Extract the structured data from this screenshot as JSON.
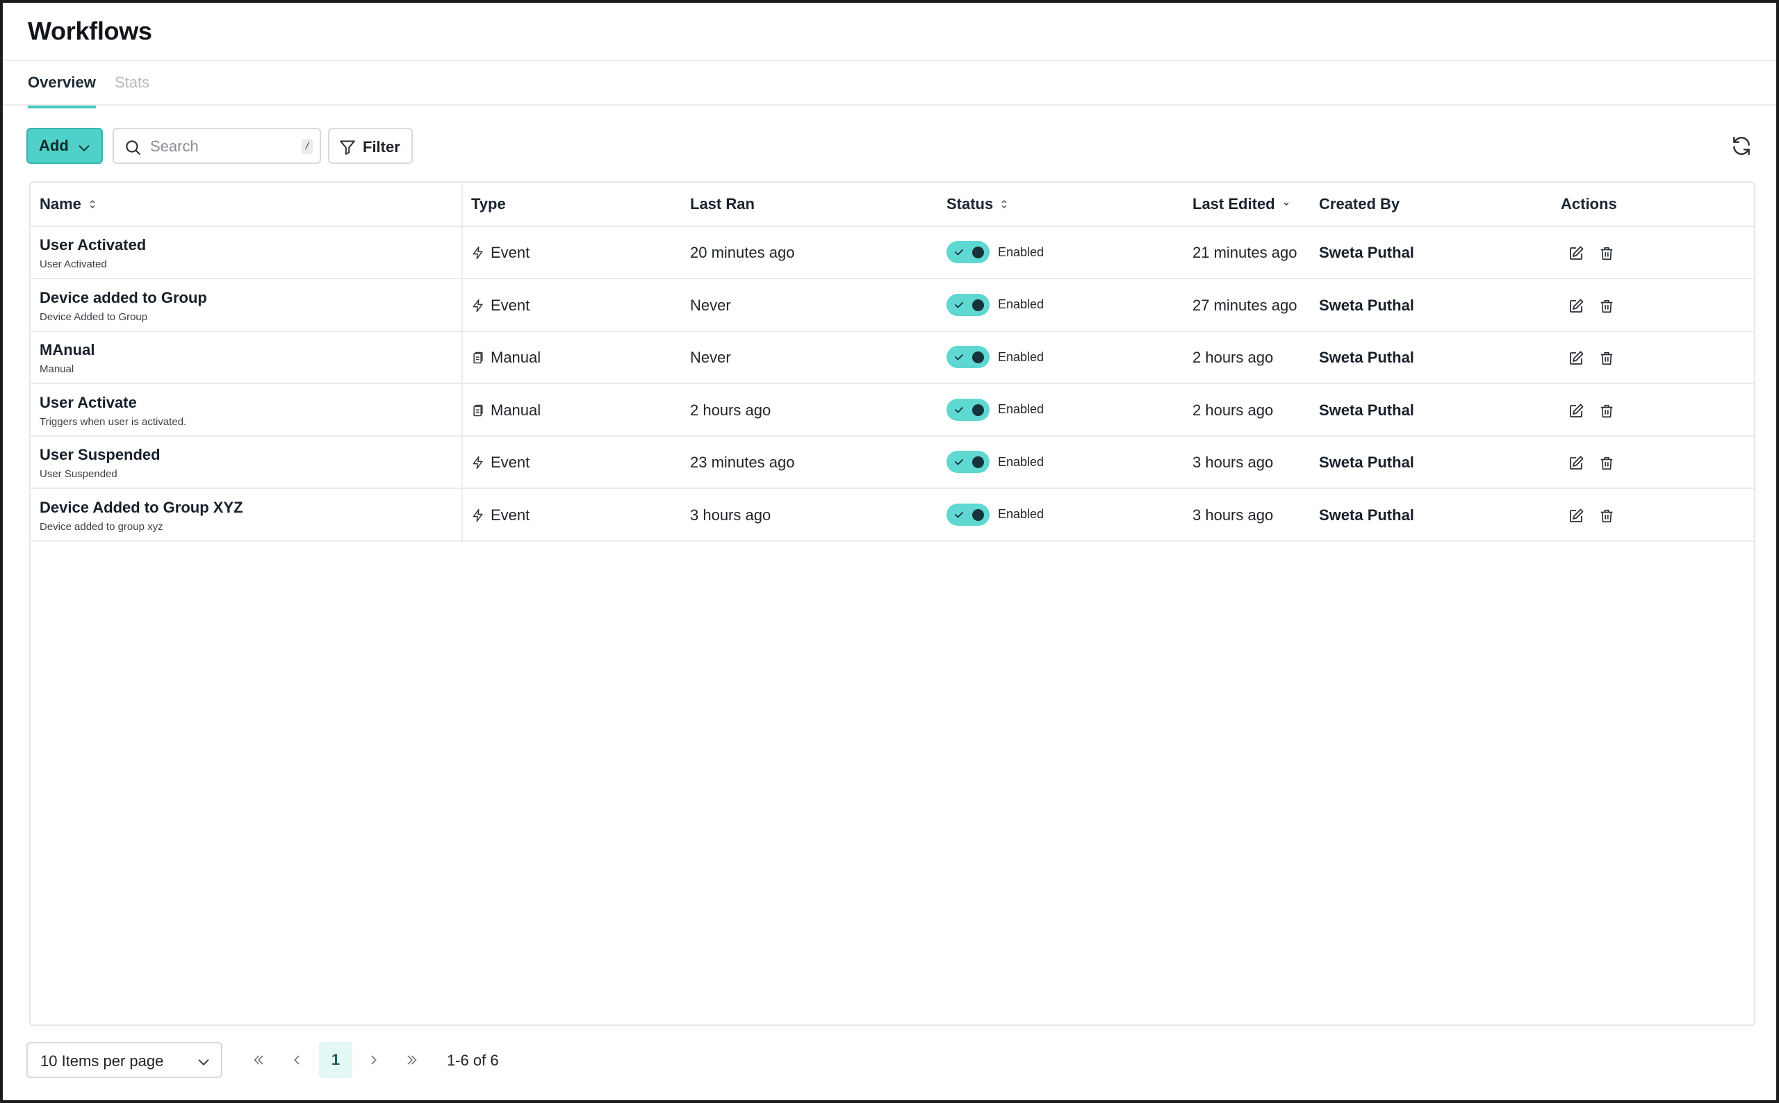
{
  "page": {
    "title": "Workflows"
  },
  "tabs": [
    {
      "label": "Overview",
      "active": true
    },
    {
      "label": "Stats",
      "active": false
    }
  ],
  "toolbar": {
    "add_label": "Add",
    "search_placeholder": "Search",
    "search_shortcut": "/",
    "filter_label": "Filter"
  },
  "table": {
    "columns": [
      "Name",
      "Type",
      "Last Ran",
      "Status",
      "Last Edited",
      "Created By",
      "Actions"
    ],
    "rows": [
      {
        "name": "User Activated",
        "description": "User Activated",
        "type": "Event",
        "last_ran": "20 minutes ago",
        "status": "Enabled",
        "last_edited": "21 minutes ago",
        "created_by": "Sweta Puthal"
      },
      {
        "name": "Device added to Group",
        "description": "Device Added to Group",
        "type": "Event",
        "last_ran": "Never",
        "status": "Enabled",
        "last_edited": "27 minutes ago",
        "created_by": "Sweta Puthal"
      },
      {
        "name": "MAnual",
        "description": "Manual",
        "type": "Manual",
        "last_ran": "Never",
        "status": "Enabled",
        "last_edited": "2 hours ago",
        "created_by": "Sweta Puthal"
      },
      {
        "name": "User Activate",
        "description": "Triggers when user is activated.",
        "type": "Manual",
        "last_ran": "2 hours ago",
        "status": "Enabled",
        "last_edited": "2 hours ago",
        "created_by": "Sweta Puthal"
      },
      {
        "name": "User Suspended",
        "description": "User Suspended",
        "type": "Event",
        "last_ran": "23 minutes ago",
        "status": "Enabled",
        "last_edited": "3 hours ago",
        "created_by": "Sweta Puthal"
      },
      {
        "name": "Device Added to Group XYZ",
        "description": "Device added to group xyz",
        "type": "Event",
        "last_ran": "3 hours ago",
        "status": "Enabled",
        "last_edited": "3 hours ago",
        "created_by": "Sweta Puthal"
      }
    ]
  },
  "pagination": {
    "per_page_label": "10 Items per page",
    "current_page": "1",
    "range": "1-6 of 6"
  },
  "colors": {
    "accent": "#4fd1c9",
    "toggle_on": "#5ed8d0",
    "tab_underline": "#45c9c2"
  },
  "icons": {
    "add_dropdown": "chevron-down-icon",
    "search": "search-icon",
    "filter": "filter-icon",
    "refresh": "refresh-icon",
    "type_event": "lightning-icon",
    "type_manual": "clipboard-icon",
    "edit": "edit-icon",
    "delete": "trash-icon"
  }
}
